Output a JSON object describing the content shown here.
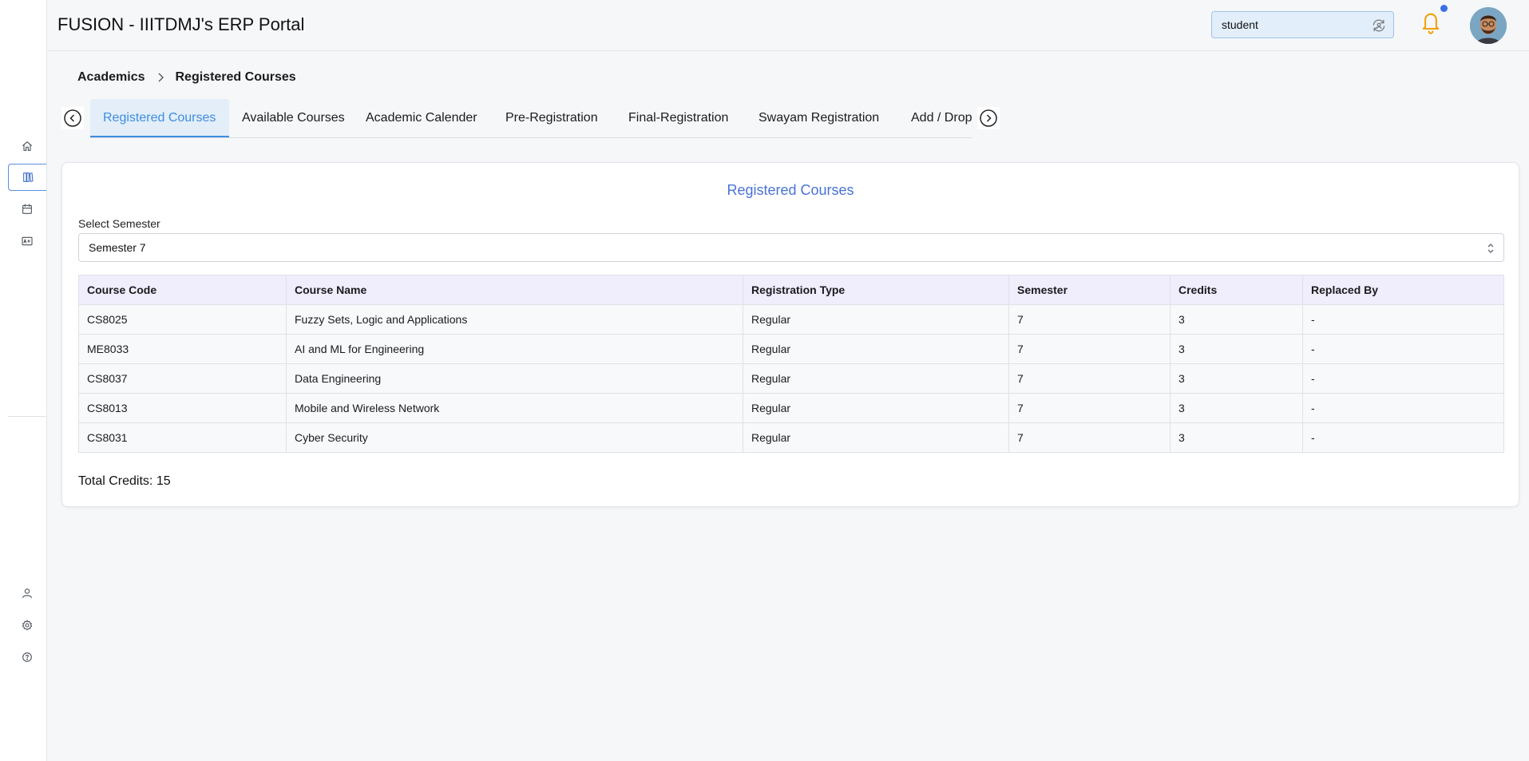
{
  "header": {
    "title": "FUSION - IIITDMJ's ERP Portal",
    "role": "student"
  },
  "sidebar": {
    "items": [
      {
        "icon": "home-icon"
      },
      {
        "icon": "books-icon",
        "active": true
      },
      {
        "icon": "calendar-icon"
      },
      {
        "icon": "grade-icon"
      },
      {
        "icon": "user-icon"
      },
      {
        "icon": "gear-icon"
      },
      {
        "icon": "help-icon"
      }
    ]
  },
  "breadcrumb": {
    "parent": "Academics",
    "current": "Registered Courses"
  },
  "tabs": [
    {
      "label": "Registered Courses",
      "active": true
    },
    {
      "label": "Available Courses"
    },
    {
      "label": "Academic Calender"
    },
    {
      "label": "Pre-Registration"
    },
    {
      "label": "Final-Registration"
    },
    {
      "label": "Swayam Registration"
    },
    {
      "label": "Add / Drop"
    }
  ],
  "card": {
    "title": "Registered Courses",
    "semester_label": "Select Semester",
    "semester_value": "Semester 7",
    "total_credits": "Total Credits: 15"
  },
  "table": {
    "headers": [
      "Course Code",
      "Course Name",
      "Registration Type",
      "Semester",
      "Credits",
      "Replaced By"
    ],
    "rows": [
      [
        "CS8025",
        "Fuzzy Sets, Logic and Applications",
        "Regular",
        "7",
        "3",
        "-"
      ],
      [
        "ME8033",
        "AI and ML for Engineering",
        "Regular",
        "7",
        "3",
        "-"
      ],
      [
        "CS8037",
        "Data Engineering",
        "Regular",
        "7",
        "3",
        "-"
      ],
      [
        "CS8013",
        "Mobile and Wireless Network",
        "Regular",
        "7",
        "3",
        "-"
      ],
      [
        "CS8031",
        "Cyber Security",
        "Regular",
        "7",
        "3",
        "-"
      ]
    ]
  },
  "colors": {
    "accent": "#3e8de0",
    "title_blue": "#4a73d6",
    "header_bg": "#f0edfc",
    "notification_dot": "#3b6ee6",
    "bell": "#f2a007"
  }
}
